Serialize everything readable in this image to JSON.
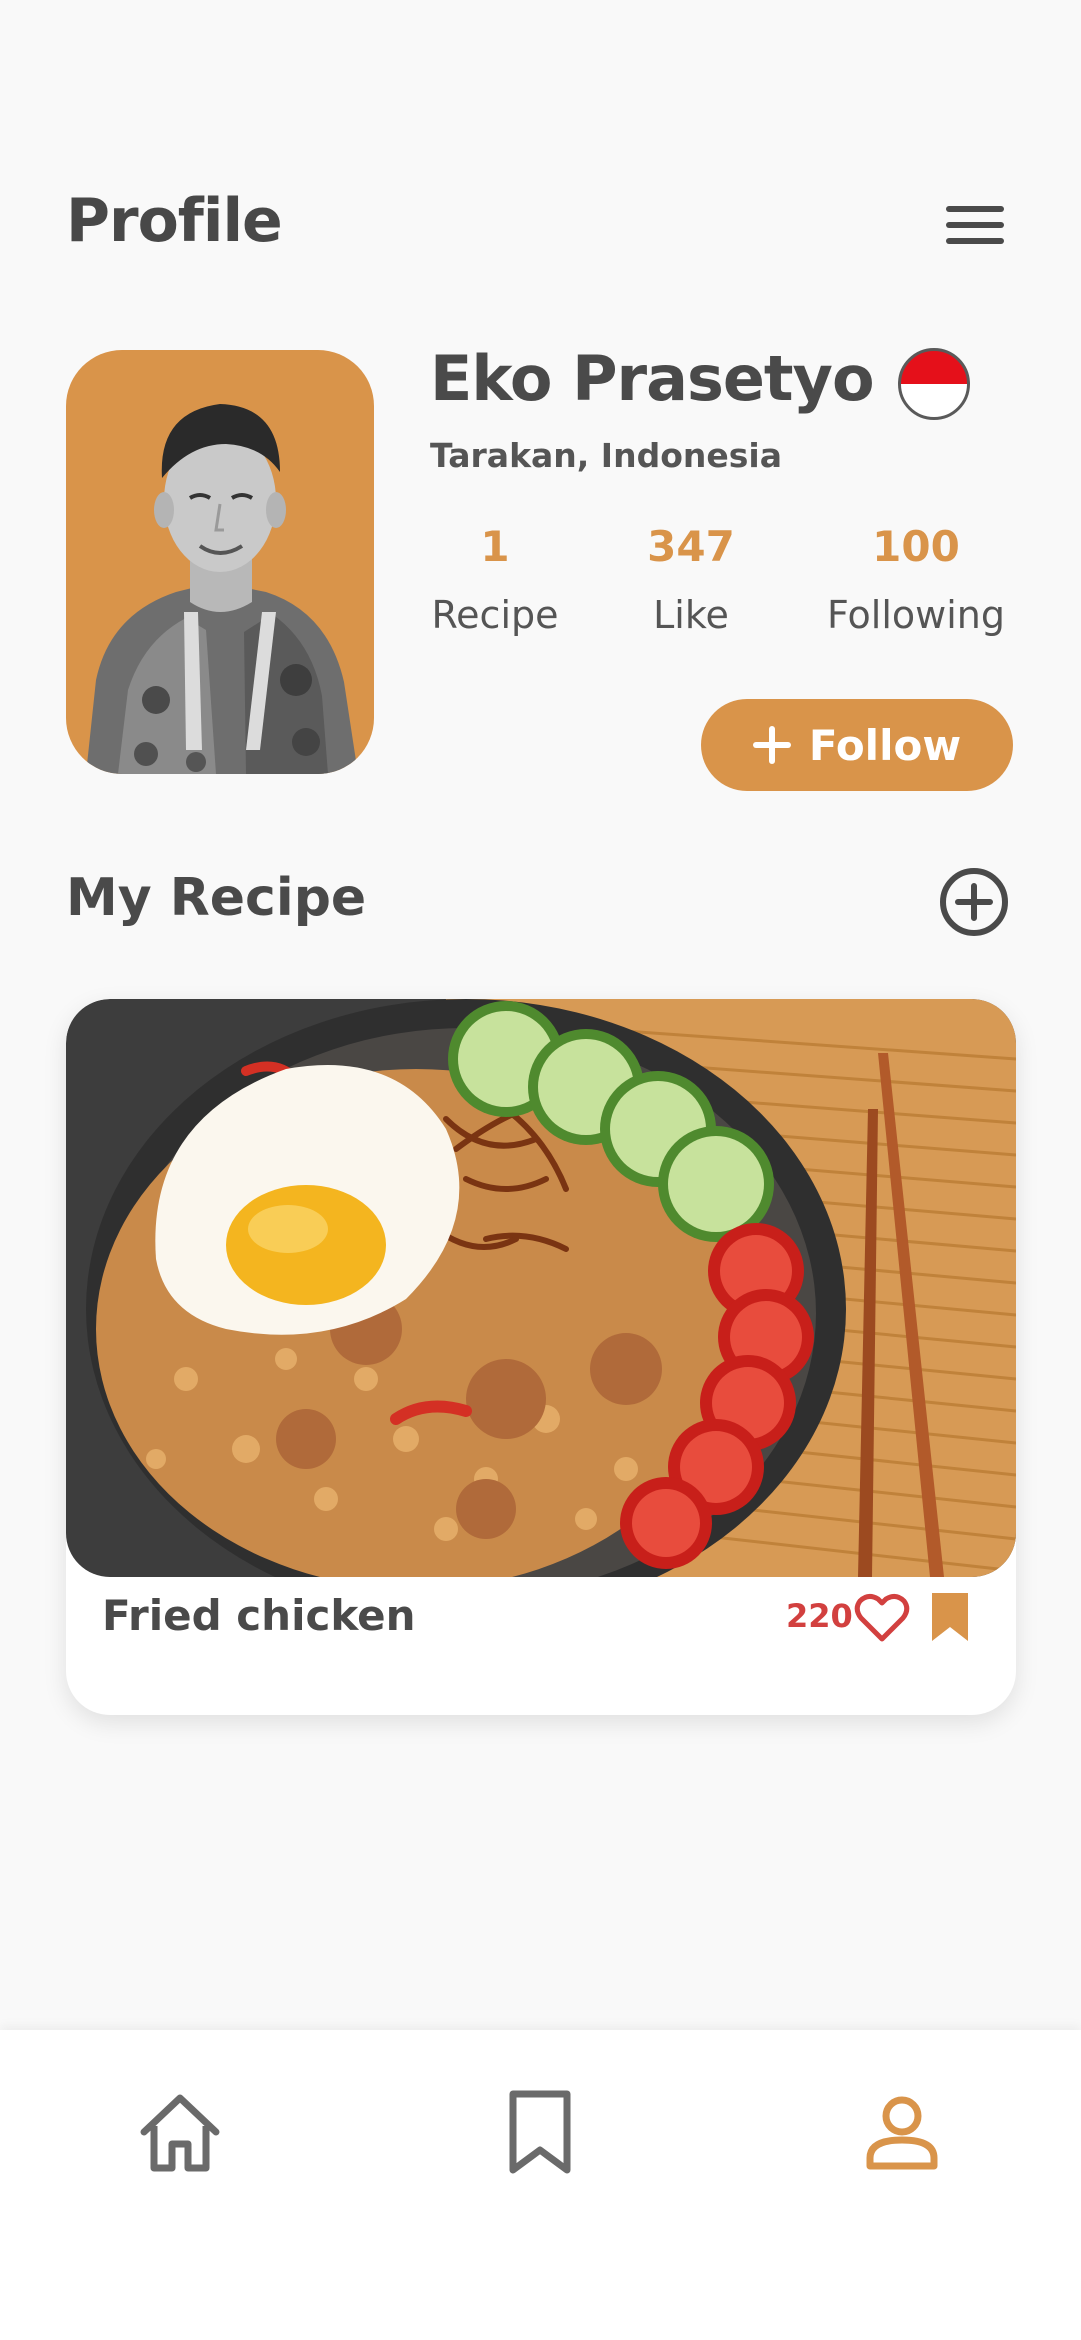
{
  "header": {
    "title": "Profile",
    "menu_icon": "hamburger-menu-icon"
  },
  "profile": {
    "name": "Eko Prasetyo",
    "location": "Tarakan, Indonesia",
    "flag": "indonesia-flag-icon",
    "stats": {
      "recipe": {
        "value": "1",
        "label": "Recipe"
      },
      "like": {
        "value": "347",
        "label": "Like"
      },
      "following": {
        "value": "100",
        "label": "Following"
      }
    },
    "follow_label": "Follow"
  },
  "my_recipe": {
    "title": "My Recipe",
    "add_icon": "add-circle-icon",
    "items": [
      {
        "title": "Fried chicken",
        "likes": "220"
      }
    ]
  },
  "bottom_nav": {
    "items": [
      {
        "icon": "home-icon",
        "active": false
      },
      {
        "icon": "bookmark-icon",
        "active": false
      },
      {
        "icon": "user-icon",
        "active": true
      }
    ]
  },
  "colors": {
    "accent": "#d9944a",
    "background": "#f9f9f9",
    "text": "#4a4a4a",
    "like": "#d2403f",
    "flag_red": "#e5101a"
  }
}
